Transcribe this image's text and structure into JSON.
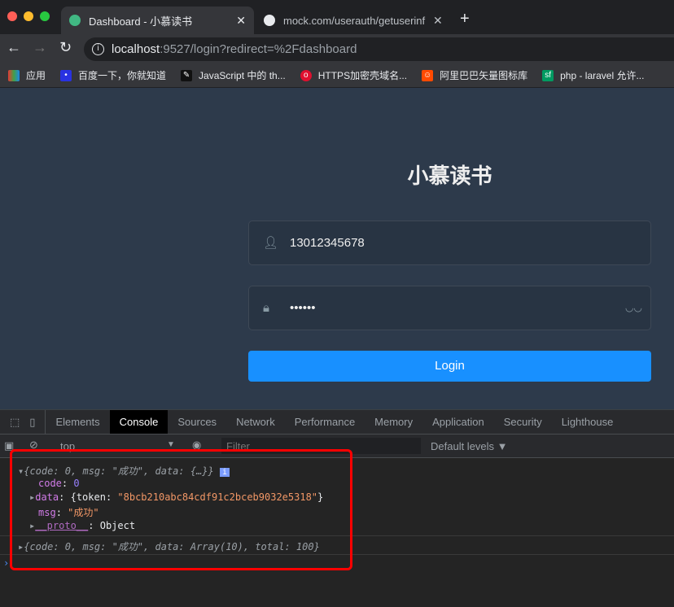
{
  "browser": {
    "tabs": [
      {
        "title": "Dashboard - 小慕读书",
        "icon": "vue-icon"
      },
      {
        "title": "mock.com/userauth/getuserinf",
        "icon": "globe-icon"
      }
    ],
    "url_host": "localhost",
    "url_rest": ":9527/login?redirect=%2Fdashboard",
    "bookmarks": [
      {
        "label": "应用",
        "icon": "apps-icon"
      },
      {
        "label": "百度一下，你就知道",
        "icon": "baidu-icon"
      },
      {
        "label": "JavaScript 中的 th...",
        "icon": "quill-icon"
      },
      {
        "label": "HTTPS加密壳域名...",
        "icon": "ring-icon"
      },
      {
        "label": "阿里巴巴矢量图标库",
        "icon": "iconfont-icon"
      },
      {
        "label": "php - laravel 允许...",
        "icon": "sf-icon"
      }
    ]
  },
  "login": {
    "title": "小慕读书",
    "username": "13012345678",
    "password": "••••••",
    "button": "Login"
  },
  "devtools": {
    "tabs": [
      "Elements",
      "Console",
      "Sources",
      "Network",
      "Performance",
      "Memory",
      "Application",
      "Security",
      "Lighthouse"
    ],
    "active_tab": "Console",
    "context": "top",
    "filter_placeholder": "Filter",
    "levels": "Default levels ▼",
    "console": {
      "line1": "{code: 0, msg: \"成功\", data: {…}}",
      "code": "0",
      "token": "\"8bcb210abc84cdf91c2bceb9032e5318\"",
      "msg": "\"成功\"",
      "proto": "Object",
      "line2": "{code: 0, msg: \"成功\", data: Array(10), total: 100}"
    }
  },
  "colors": {
    "page_bg": "#2d3a4b",
    "button": "#1890ff",
    "highlight": "#ff0000"
  }
}
